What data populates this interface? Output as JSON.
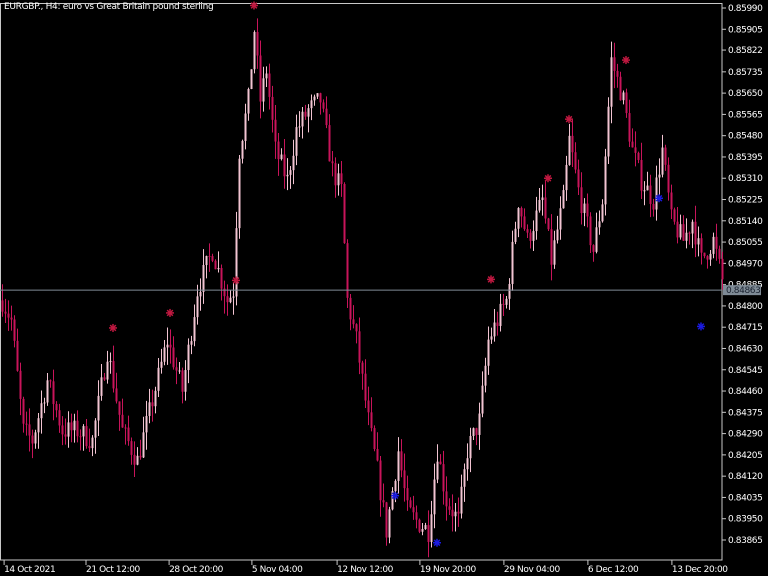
{
  "title": "EURGBP., H4:  euro vs Great Britain pound sterling",
  "colors": {
    "bull": "#f2c4d2",
    "bear": "#c8145a",
    "sell_marker": "#c01840",
    "buy_marker": "#1a1ae0",
    "price_line": "#7f8b96",
    "axis": "#ffffff"
  },
  "chart_data": {
    "type": "candlestick",
    "symbol": "EURGBP.",
    "timeframe": "H4",
    "ylim": [
      0.8382,
      0.8601
    ],
    "xlim": [
      0,
      241
    ],
    "y_ticks": [
      "0.85990",
      "0.85905",
      "0.85822",
      "0.85735",
      "0.85650",
      "0.85565",
      "0.85480",
      "0.85395",
      "0.85310",
      "0.85225",
      "0.85140",
      "0.85055",
      "0.84970",
      "0.84885",
      "0.84800",
      "0.84715",
      "0.84630",
      "0.84545",
      "0.84460",
      "0.84375",
      "0.84290",
      "0.84205",
      "0.84120",
      "0.84035",
      "0.83950",
      "0.83865"
    ],
    "x_ticks": [
      {
        "index": 0.7,
        "label": "14 Oct 2021"
      },
      {
        "index": 28,
        "label": "21 Oct 12:00"
      },
      {
        "index": 55.7,
        "label": "28 Oct 20:00"
      },
      {
        "index": 83.3,
        "label": "5 Nov 04:00"
      },
      {
        "index": 111.7,
        "label": "12 Nov 12:00"
      },
      {
        "index": 139.3,
        "label": "19 Nov 20:00"
      },
      {
        "index": 167.3,
        "label": "29 Nov 04:00"
      },
      {
        "index": 195.3,
        "label": "6 Dec 12:00"
      },
      {
        "index": 223.3,
        "label": "13 Dec 20:00"
      }
    ],
    "current_price": "0.84863",
    "close_path": [
      [
        0,
        0.84822
      ],
      [
        3,
        0.84742
      ],
      [
        7,
        0.84302
      ],
      [
        10,
        0.84262
      ],
      [
        15,
        0.84502
      ],
      [
        20,
        0.84302
      ],
      [
        25,
        0.84302
      ],
      [
        30,
        0.84262
      ],
      [
        35,
        0.84622
      ],
      [
        40,
        0.84302
      ],
      [
        45,
        0.84182
      ],
      [
        50,
        0.84422
      ],
      [
        55,
        0.84662
      ],
      [
        60,
        0.84462
      ],
      [
        65,
        0.84862
      ],
      [
        70,
        0.85022
      ],
      [
        75,
        0.84822
      ],
      [
        77,
        0.84862
      ],
      [
        79,
        0.85422
      ],
      [
        82,
        0.85622
      ],
      [
        84,
        0.85902
      ],
      [
        86,
        0.85622
      ],
      [
        88,
        0.85742
      ],
      [
        91,
        0.85422
      ],
      [
        95,
        0.85302
      ],
      [
        98,
        0.85502
      ],
      [
        102,
        0.85582
      ],
      [
        106,
        0.85622
      ],
      [
        110,
        0.85342
      ],
      [
        113,
        0.85262
      ],
      [
        115,
        0.84822
      ],
      [
        118,
        0.84662
      ],
      [
        122,
        0.84342
      ],
      [
        125,
        0.84142
      ],
      [
        128,
        0.83902
      ],
      [
        132,
        0.84222
      ],
      [
        135,
        0.83982
      ],
      [
        138,
        0.83942
      ],
      [
        142,
        0.83902
      ],
      [
        145,
        0.84222
      ],
      [
        148,
        0.84022
      ],
      [
        152,
        0.83942
      ],
      [
        155,
        0.84222
      ],
      [
        159,
        0.84342
      ],
      [
        162,
        0.84662
      ],
      [
        165,
        0.84742
      ],
      [
        168,
        0.84822
      ],
      [
        172,
        0.85222
      ],
      [
        175,
        0.85062
      ],
      [
        180,
        0.85222
      ],
      [
        183,
        0.84982
      ],
      [
        187,
        0.85222
      ],
      [
        189,
        0.85462
      ],
      [
        192,
        0.85262
      ],
      [
        197,
        0.85022
      ],
      [
        200,
        0.85222
      ],
      [
        203,
        0.85782
      ],
      [
        207,
        0.85622
      ],
      [
        210,
        0.85422
      ],
      [
        213,
        0.85302
      ],
      [
        217,
        0.85222
      ],
      [
        220,
        0.85422
      ],
      [
        223,
        0.85142
      ],
      [
        227,
        0.85062
      ],
      [
        230,
        0.85142
      ],
      [
        233,
        0.84982
      ],
      [
        237,
        0.85062
      ],
      [
        240,
        0.84902
      ]
    ],
    "sell_signals": [
      [
        84,
        0.86
      ],
      [
        37,
        0.84712
      ],
      [
        56,
        0.84772
      ],
      [
        78,
        0.84902
      ],
      [
        163,
        0.84906
      ],
      [
        182,
        0.8531
      ],
      [
        189,
        0.85546
      ],
      [
        208,
        0.85782
      ]
    ],
    "buy_signals": [
      [
        131,
        0.84042
      ],
      [
        145,
        0.83854
      ],
      [
        219,
        0.8523
      ],
      [
        233,
        0.84718
      ]
    ]
  }
}
